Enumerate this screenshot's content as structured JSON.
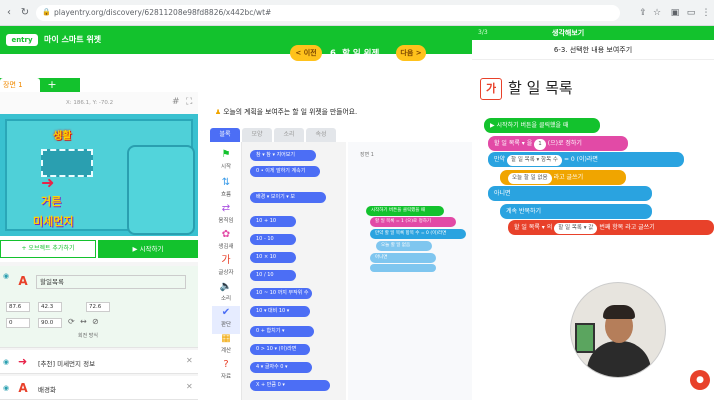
{
  "browser": {
    "url": "playentry.org/discovery/62811208e98fd8826/x442bc/wt#"
  },
  "header": {
    "logo": "entry",
    "project_name": "마이 스마트 위젯",
    "prev_label": "< 이전",
    "lesson_title": "6. 할 일 위젯",
    "next_label": "다음 >"
  },
  "tabs": {
    "scene_tab": "장면 1",
    "add_tab": "+"
  },
  "stage": {
    "coord_readout": "X: 186.1, Y: -70.2",
    "text_category": "생활",
    "text_big1": "거른",
    "text_big2": "미세먼지"
  },
  "buttons": {
    "add_object": "+ 오브젝트 추가하기",
    "run": "▶ 시작하기"
  },
  "objects": [
    {
      "name": "할일목록",
      "x": "87.6",
      "y": "42.3",
      "size": "72.6",
      "rotation": "0",
      "direction": "90.0",
      "label_rotation": "회전 방식"
    },
    {
      "name": "[추천] 미세먼지 정보"
    },
    {
      "name": "배경화"
    }
  ],
  "instruction": "오늘의 계획을 보여주는 할 일 위젯을 만들어요.",
  "palette": {
    "tabs": [
      "블록",
      "모양",
      "소리",
      "속성"
    ],
    "categories": [
      {
        "label": "시작",
        "icon": "flag-icon",
        "color": "#13c22d"
      },
      {
        "label": "흐름",
        "icon": "flow-icon",
        "color": "#3a9be8"
      },
      {
        "label": "움직임",
        "icon": "move-icon",
        "color": "#a951e0"
      },
      {
        "label": "생김새",
        "icon": "looks-icon",
        "color": "#e24aa6"
      },
      {
        "label": "글상자",
        "icon": "text-icon",
        "color": "#e8412a"
      },
      {
        "label": "소리",
        "icon": "sound-icon",
        "color": "#6ab03c"
      },
      {
        "label": "판단",
        "icon": "judge-icon",
        "color": "#4c6ef5"
      },
      {
        "label": "계산",
        "icon": "calc-icon",
        "color": "#f0a500"
      },
      {
        "label": "자료",
        "icon": "data-icon",
        "color": "#e8412a"
      }
    ],
    "blocks": [
      "참 ▾ 참 ▾ 지어보기",
      "0 • 이게 말하기 계속기",
      "배경 ▾ 보이기 ▾ 보",
      "10 + 10",
      "10 - 10",
      "10 × 10",
      "10 / 10",
      "10 ~ 10 까지 무작위 수",
      "10 ▾ 대비 10 ▾",
      "0 + 합치기 ▾",
      "0 > 10 ▾ (이)라면",
      "4 ▾ 글자수 0 ▾",
      "X + 만큼 0 ▾"
    ]
  },
  "workspace": {
    "tag": "장면 1",
    "blocks": [
      "시작하기 버튼을 클릭했을 때",
      "할 일 목록 = 1 (으)로 정하기",
      "만약 할 일 목록 항목 수 = 0 (이)라면",
      "오늘 할 일 없음",
      "아니면"
    ]
  },
  "help": {
    "page": "3/3",
    "title": "생각해보기",
    "subtitle": "6-3. 선택한 내용 보여주기",
    "ga": "가",
    "list_title": "할 일 목록",
    "blocks": [
      {
        "text": "시작하기 버튼을 클릭했을 때",
        "color": "#13c22d"
      },
      {
        "text": "할 일 목록 ▾ 을",
        "chip": "1",
        "tail": "(으)로 정하기",
        "color": "#e24aa6"
      },
      {
        "text": "만약",
        "chip": "할 일 목록 ▾ 항목 수",
        "tail": "= 0 (이)라면",
        "color": "#2aa3e0"
      },
      {
        "text": "오늘 할 일 없음",
        "tail": "라고 글쓰기",
        "color": "#f0a500"
      },
      {
        "text": "아니면",
        "color": "#2aa3e0"
      },
      {
        "text": "계속 반복하기",
        "color": "#2aa3e0"
      },
      {
        "text": "할 일 목록 ▾ 의",
        "chip": "할 일 목록 ▾ 값",
        "tail": "번째 항목 라고 글쓰기",
        "color": "#e8412a"
      }
    ]
  },
  "colors": {
    "brand_green": "#13c22d",
    "accent_yellow": "#ffc21c"
  }
}
